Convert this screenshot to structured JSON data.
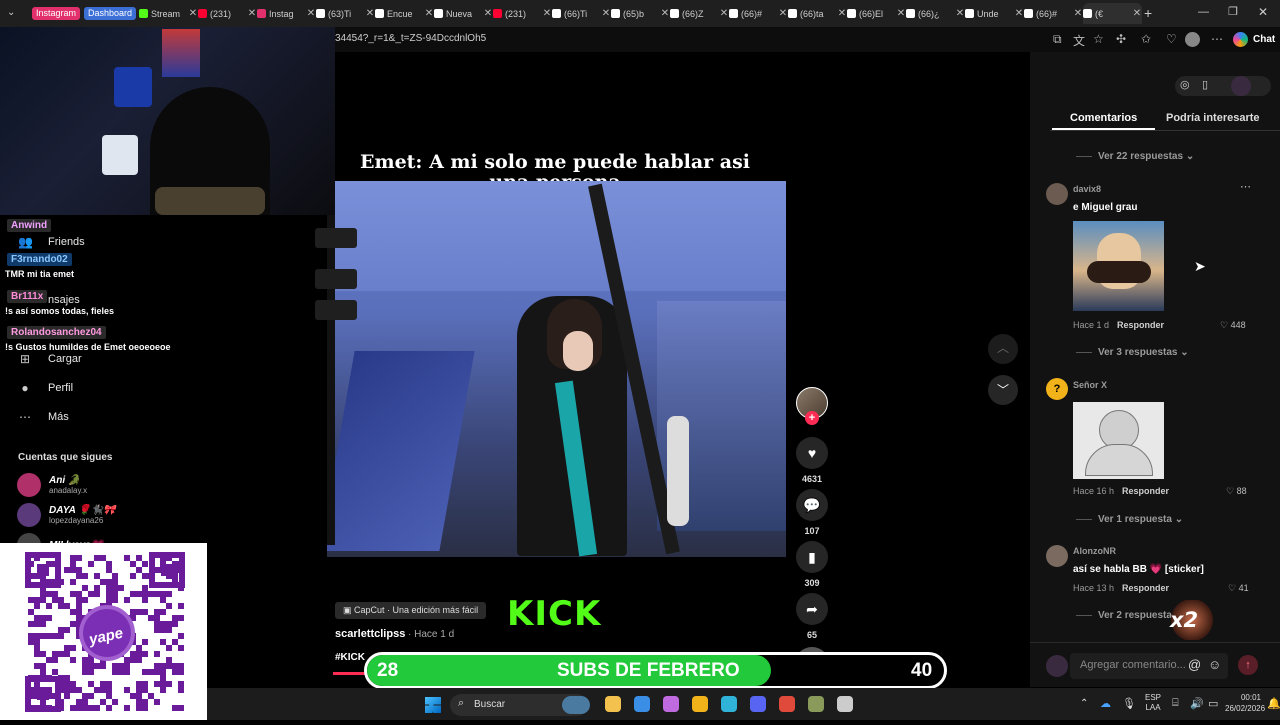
{
  "browser": {
    "tabs": [
      {
        "label": "Stream",
        "color": "#53fc18"
      },
      {
        "label": "(231) ",
        "color": "#ff0033"
      },
      {
        "label": "Instag",
        "color": "#e1306c"
      },
      {
        "label": "(63)Ti",
        "color": "#ffffff"
      },
      {
        "label": "Encue",
        "color": "#ffffff"
      },
      {
        "label": "Nueva",
        "color": "#ffffff"
      },
      {
        "label": "(231) ",
        "color": "#ff0033"
      },
      {
        "label": "(66)Ti",
        "color": "#ffffff"
      },
      {
        "label": "(65)b",
        "color": "#ffffff"
      },
      {
        "label": "(66)Z",
        "color": "#ffffff"
      },
      {
        "label": "(66)#",
        "color": "#ffffff"
      },
      {
        "label": "(66)ta",
        "color": "#ffffff"
      },
      {
        "label": "(66)El",
        "color": "#ffffff"
      },
      {
        "label": "(66)¿",
        "color": "#ffffff"
      },
      {
        "label": "Unde",
        "color": "#ffffff"
      },
      {
        "label": "(66)#",
        "color": "#ffffff"
      },
      {
        "label": "(€",
        "color": "#ffffff"
      }
    ],
    "pills": {
      "instagram": "Instagram",
      "dashboard": "Dashboard"
    },
    "url": "34454?_r=1&_t=ZS-94DccdnlOh5",
    "copilot_label": "Chat"
  },
  "chat_overlay": {
    "messages": [
      {
        "user": "Anwind",
        "text": ""
      },
      {
        "user": "F3rnando02",
        "text": "TMR mi tia emet"
      },
      {
        "user": "Br111x",
        "text": "!s así somos todas, fieles"
      },
      {
        "user": "Rolandosanchez04",
        "text": "!s Gustos humildes de Emet oeoeoeoe"
      }
    ]
  },
  "sidebar": {
    "items": [
      {
        "icon": "friends-icon",
        "label": "Friends"
      },
      {
        "icon": "messages-icon",
        "label": "nsajes"
      },
      {
        "icon": "upload-icon",
        "label": "Cargar"
      },
      {
        "icon": "profile-icon",
        "label": "Perfil"
      },
      {
        "icon": "more-icon",
        "label": "Más"
      }
    ],
    "following_title": "Cuentas que sigues",
    "following": [
      {
        "name": "Ani 🐊",
        "handle": "anadalay.x"
      },
      {
        "name": "DAYA 🌹🐈‍⬛🎀",
        "handle": "lopezdayana26"
      },
      {
        "name": "MII lyeys💗",
        "handle": ""
      }
    ]
  },
  "video": {
    "caption": "Emet: A mi solo me puede hablar asi una persona",
    "capcut_label": "CapCut · Una edición más fácil",
    "author": "scarlettclipss",
    "time": " · Hace 1 d",
    "hashtag": "#KICK",
    "kick_logo": "KICK",
    "likes": "4631",
    "comments": "107",
    "saves": "309",
    "shares": "65"
  },
  "comments_panel": {
    "tabs": [
      "Comentarios",
      "Podría interesarte"
    ],
    "active_tab": 0,
    "items": [
      {
        "more_replies": "Ver 22 respuestas"
      },
      {
        "user": "davix8",
        "text": "e Miguel grau",
        "time": "Hace 1 d",
        "reply": "Responder",
        "likes": "448",
        "more_replies": "Ver 3 respuestas"
      },
      {
        "user": "Señor X",
        "text": "",
        "time": "Hace 16 h",
        "reply": "Responder",
        "likes": "88",
        "more_replies": "Ver 1 respuesta"
      },
      {
        "user": "AlonzoNR",
        "text": "así se habla BB 💗 [sticker]",
        "time": "Hace 13 h",
        "reply": "Responder",
        "likes": "41",
        "more_replies": "Ver 2 respuestas"
      }
    ],
    "comment_placeholder": "Agregar comentario...",
    "badge": "x2"
  },
  "subs_goal": {
    "current": "28",
    "label": "SUBS DE FEBRERO",
    "target": "40",
    "progress": 0.7,
    "color": "#22c93a"
  },
  "taskbar": {
    "search_label": "Buscar",
    "lang_top": "ESP",
    "lang_bottom": "LAA",
    "time": "00:01",
    "date": "26/02/2026"
  },
  "colors": {
    "accent_pink": "#fe2c55",
    "kick_green": "#53fc18",
    "panel_bg": "#121212"
  }
}
